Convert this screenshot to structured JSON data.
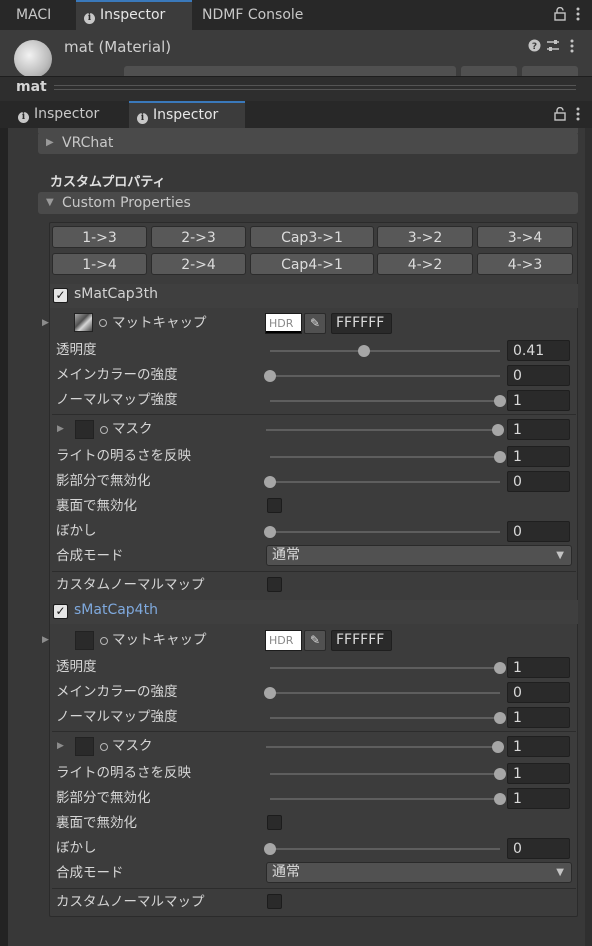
{
  "top_tabs": [
    "MACI",
    "Inspector",
    "NDMF Console"
  ],
  "material": {
    "title": "mat (Material)"
  },
  "mat_bar": {
    "label": "mat"
  },
  "inner_tabs": [
    "Inspector",
    "Inspector"
  ],
  "vrchat": {
    "label": "VRChat"
  },
  "custom_props": {
    "heading": "カスタムプロパティ",
    "foldout": "Custom Properties"
  },
  "buttons": {
    "row1": [
      "1->3",
      "2->3",
      "Cap3->1",
      "3->2",
      "3->4"
    ],
    "row2": [
      "1->4",
      "2->4",
      "Cap4->1",
      "4->2",
      "4->3"
    ]
  },
  "icons": {
    "lock": "lock-icon",
    "menu": "kebab-menu-icon",
    "help": "help-icon",
    "settings": "sliders-icon",
    "picker": "eyedropper-icon",
    "check": "checkmark-icon"
  },
  "colors": {
    "accent": "#3a79bb",
    "selected_text": "#7fa9dd"
  },
  "cap3": {
    "name": "sMatCap3th",
    "matcap": {
      "label": "マットキャップ",
      "hdr": "HDR",
      "hex": "FFFFFF"
    },
    "rows": [
      {
        "label": "透明度",
        "value": "0.41",
        "level": 0.41
      },
      {
        "label": "メインカラーの強度",
        "value": "0",
        "level": 0
      },
      {
        "label": "ノーマルマップ強度",
        "value": "1",
        "level": 1
      }
    ],
    "mask": {
      "label": "マスク",
      "value": "1",
      "level": 1
    },
    "rows2": [
      {
        "label": "ライトの明るさを反映",
        "value": "1",
        "level": 1
      },
      {
        "label": "影部分で無効化",
        "value": "0",
        "level": 0
      }
    ],
    "backface": {
      "label": "裏面で無効化"
    },
    "blur": {
      "label": "ぼかし",
      "value": "0",
      "level": 0
    },
    "blend": {
      "label": "合成モード",
      "value": "通常"
    },
    "custom_normal": {
      "label": "カスタムノーマルマップ"
    }
  },
  "cap4": {
    "name": "sMatCap4th",
    "matcap": {
      "label": "マットキャップ",
      "hdr": "HDR",
      "hex": "FFFFFF"
    },
    "rows": [
      {
        "label": "透明度",
        "value": "1",
        "level": 1
      },
      {
        "label": "メインカラーの強度",
        "value": "0",
        "level": 0
      },
      {
        "label": "ノーマルマップ強度",
        "value": "1",
        "level": 1
      }
    ],
    "mask": {
      "label": "マスク",
      "value": "1",
      "level": 1
    },
    "rows2": [
      {
        "label": "ライトの明るさを反映",
        "value": "1",
        "level": 1
      },
      {
        "label": "影部分で無効化",
        "value": "1",
        "level": 1
      }
    ],
    "backface": {
      "label": "裏面で無効化"
    },
    "blur": {
      "label": "ぼかし",
      "value": "0",
      "level": 0
    },
    "blend": {
      "label": "合成モード",
      "value": "通常"
    },
    "custom_normal": {
      "label": "カスタムノーマルマップ"
    }
  }
}
